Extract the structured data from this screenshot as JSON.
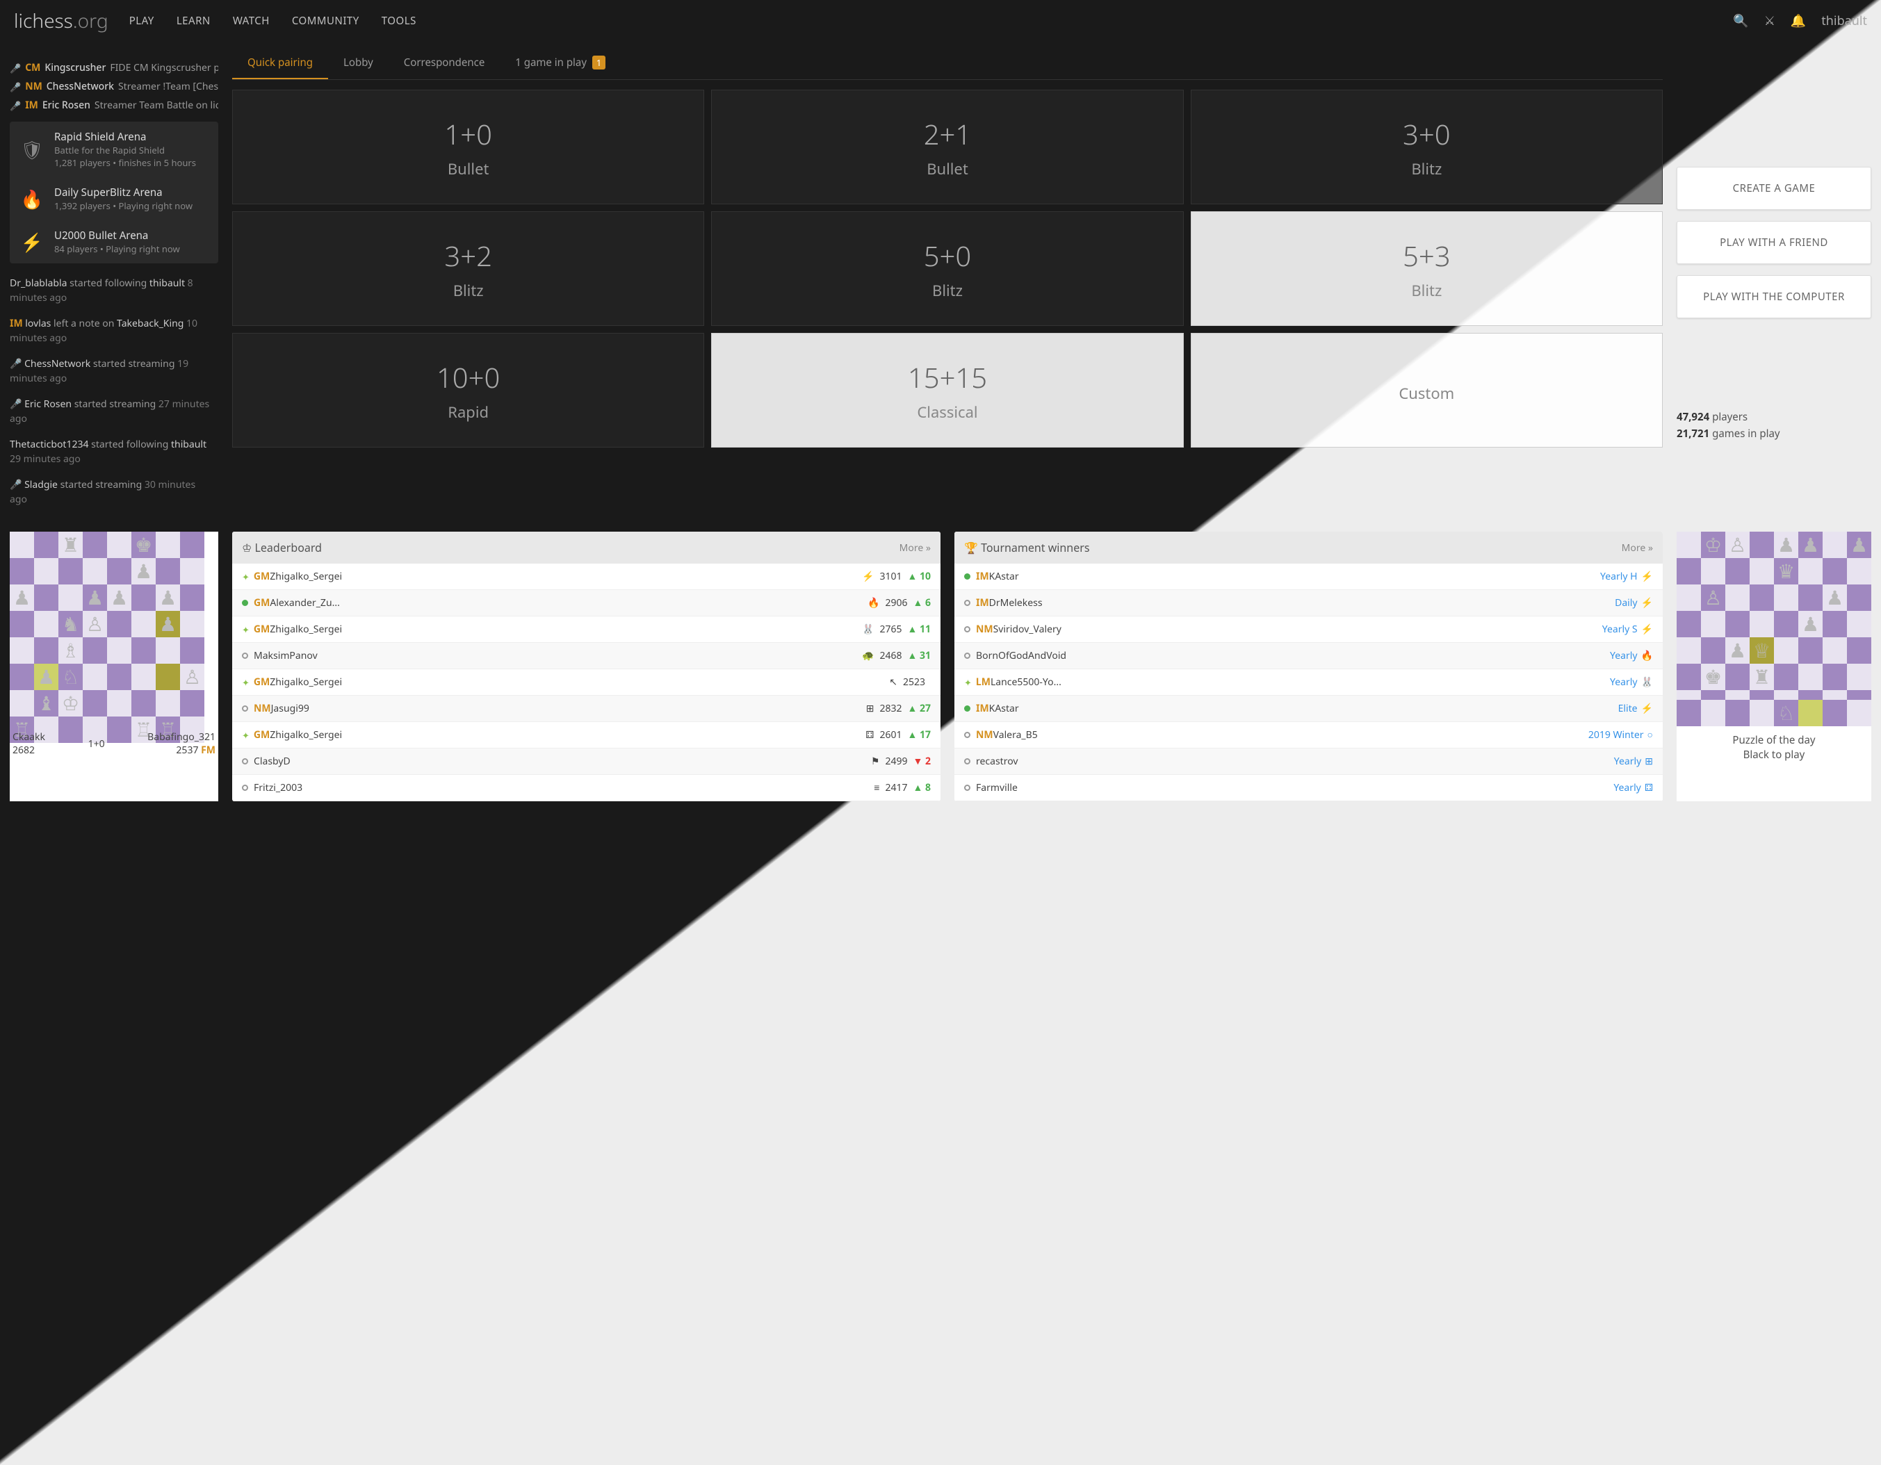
{
  "header": {
    "logo_main": "lichess",
    "logo_suffix": ".org",
    "nav": [
      "PLAY",
      "LEARN",
      "WATCH",
      "COMMUNITY",
      "TOOLS"
    ],
    "username": "thibault"
  },
  "streamers": [
    {
      "title": "CM",
      "name": "Kingscrusher",
      "desc": "FIDE CM Kingscrusher pla..."
    },
    {
      "title": "NM",
      "name": "ChessNetwork",
      "desc": "Streamer !Team [Chess..."
    },
    {
      "title": "IM",
      "name": "Eric Rosen",
      "desc": "Streamer Team Battle on liche..."
    }
  ],
  "tournaments": [
    {
      "icon": "shield",
      "title": "Rapid Shield Arena",
      "sub": "Battle for the Rapid Shield",
      "sub2": "1,281 players • finishes  in 5 hours"
    },
    {
      "icon": "flame",
      "title": "Daily SuperBlitz Arena",
      "sub": "1,392 players • Playing right now"
    },
    {
      "icon": "bolt",
      "title": "U2000 Bullet Arena",
      "sub": "84 players • Playing right now"
    }
  ],
  "feed": [
    {
      "pre": "",
      "u1": "Dr_blablabla",
      "mid": " started following ",
      "u2": "thibault",
      "time": " 8 minutes ago"
    },
    {
      "pre": "IM ",
      "u1": "lovlas",
      "mid": " left a note on ",
      "u2": "Takeback_King",
      "time": " 10 minutes ago"
    },
    {
      "pre": "🎤 ",
      "u1": "ChessNetwork",
      "mid": " started streaming",
      "u2": "",
      "time": " 19 minutes ago"
    },
    {
      "pre": "🎤 ",
      "u1": "Eric Rosen",
      "mid": " started streaming",
      "u2": "",
      "time": " 27 minutes ago"
    },
    {
      "pre": "",
      "u1": "Thetacticbot1234",
      "mid": " started following ",
      "u2": "thibault",
      "time": " 29 minutes ago"
    },
    {
      "pre": "🎤 ",
      "u1": "Sladgie",
      "mid": " started streaming",
      "u2": "",
      "time": " 30 minutes ago"
    }
  ],
  "tabs": {
    "quick": "Quick pairing",
    "lobby": "Lobby",
    "corr": "Correspondence",
    "inplay_pre": "1 game in play",
    "inplay_badge": "1"
  },
  "pairing": [
    {
      "t": "1+0",
      "m": "Bullet",
      "light": false
    },
    {
      "t": "2+1",
      "m": "Bullet",
      "light": false
    },
    {
      "t": "3+0",
      "m": "Blitz",
      "light": false
    },
    {
      "t": "3+2",
      "m": "Blitz",
      "light": false
    },
    {
      "t": "5+0",
      "m": "Blitz",
      "light": false
    },
    {
      "t": "5+3",
      "m": "Blitz",
      "light": true
    },
    {
      "t": "10+0",
      "m": "Rapid",
      "light": false
    },
    {
      "t": "15+15",
      "m": "Classical",
      "light": true
    },
    {
      "t": "",
      "m": "Custom",
      "light": true
    }
  ],
  "actions": {
    "create": "CREATE A GAME",
    "friend": "PLAY WITH A FRIEND",
    "computer": "PLAY WITH THE COMPUTER"
  },
  "stats": {
    "players_n": "47,924",
    "players_l": "players",
    "games_n": "21,721",
    "games_l": "games in play"
  },
  "game_preview": {
    "white": "Ckaakk",
    "white_r": "2682",
    "black": "Babafingo_321",
    "black_r": "2537",
    "black_t": "FM",
    "tc": "1+0"
  },
  "leaderboard": {
    "title": "Leaderboard",
    "more": "More »",
    "rows": [
      {
        "s": "wing",
        "t": "GM",
        "n": "Zhigalko_Sergei",
        "i": "⚡",
        "r": "3101",
        "d": "▲ 10",
        "dc": "up"
      },
      {
        "s": "green",
        "t": "GM",
        "n": "Alexander_Zu...",
        "i": "🔥",
        "r": "2906",
        "d": "▲ 6",
        "dc": "up"
      },
      {
        "s": "wing",
        "t": "GM",
        "n": "Zhigalko_Sergei",
        "i": "🐰",
        "r": "2765",
        "d": "▲ 11",
        "dc": "up"
      },
      {
        "s": "gray",
        "t": "",
        "n": "MaksimPanov",
        "i": "🐢",
        "r": "2468",
        "d": "▲ 31",
        "dc": "up"
      },
      {
        "s": "wing",
        "t": "GM",
        "n": "Zhigalko_Sergei",
        "i": "↖",
        "r": "2523",
        "d": "",
        "dc": ""
      },
      {
        "s": "gray",
        "t": "NM",
        "n": "Jasugi99",
        "i": "⊞",
        "r": "2832",
        "d": "▲ 27",
        "dc": "up"
      },
      {
        "s": "wing",
        "t": "GM",
        "n": "Zhigalko_Sergei",
        "i": "⚃",
        "r": "2601",
        "d": "▲ 17",
        "dc": "up"
      },
      {
        "s": "gray",
        "t": "",
        "n": "ClasbyD",
        "i": "⚑",
        "r": "2499",
        "d": "▼ 2",
        "dc": "down"
      },
      {
        "s": "gray",
        "t": "",
        "n": "Fritzi_2003",
        "i": "≡",
        "r": "2417",
        "d": "▲ 8",
        "dc": "up"
      }
    ]
  },
  "winners": {
    "title": "Tournament winners",
    "more": "More »",
    "rows": [
      {
        "s": "green",
        "t": "IM",
        "n": "KAstar",
        "e": "Yearly H",
        "i": "⚡"
      },
      {
        "s": "gray",
        "t": "IM",
        "n": "DrMelekess",
        "e": "Daily",
        "i": "⚡"
      },
      {
        "s": "gray",
        "t": "NM",
        "n": "Sviridov_Valery",
        "e": "Yearly S",
        "i": "⚡"
      },
      {
        "s": "gray",
        "t": "",
        "n": "BornOfGodAndVoid",
        "e": "Yearly",
        "i": "🔥"
      },
      {
        "s": "wing",
        "t": "LM",
        "n": "Lance5500-Yo...",
        "e": "Yearly",
        "i": "🐰"
      },
      {
        "s": "green",
        "t": "IM",
        "n": "KAstar",
        "e": "Elite",
        "i": "⚡"
      },
      {
        "s": "gray",
        "t": "NM",
        "n": "Valera_B5",
        "e": "2019 Winter",
        "i": "○"
      },
      {
        "s": "gray",
        "t": "",
        "n": "recastrov",
        "e": "Yearly",
        "i": "⊞"
      },
      {
        "s": "gray",
        "t": "",
        "n": "Farmville",
        "e": "Yearly",
        "i": "⚃"
      }
    ]
  },
  "puzzle": {
    "t1": "Puzzle of the day",
    "t2": "Black to play"
  }
}
